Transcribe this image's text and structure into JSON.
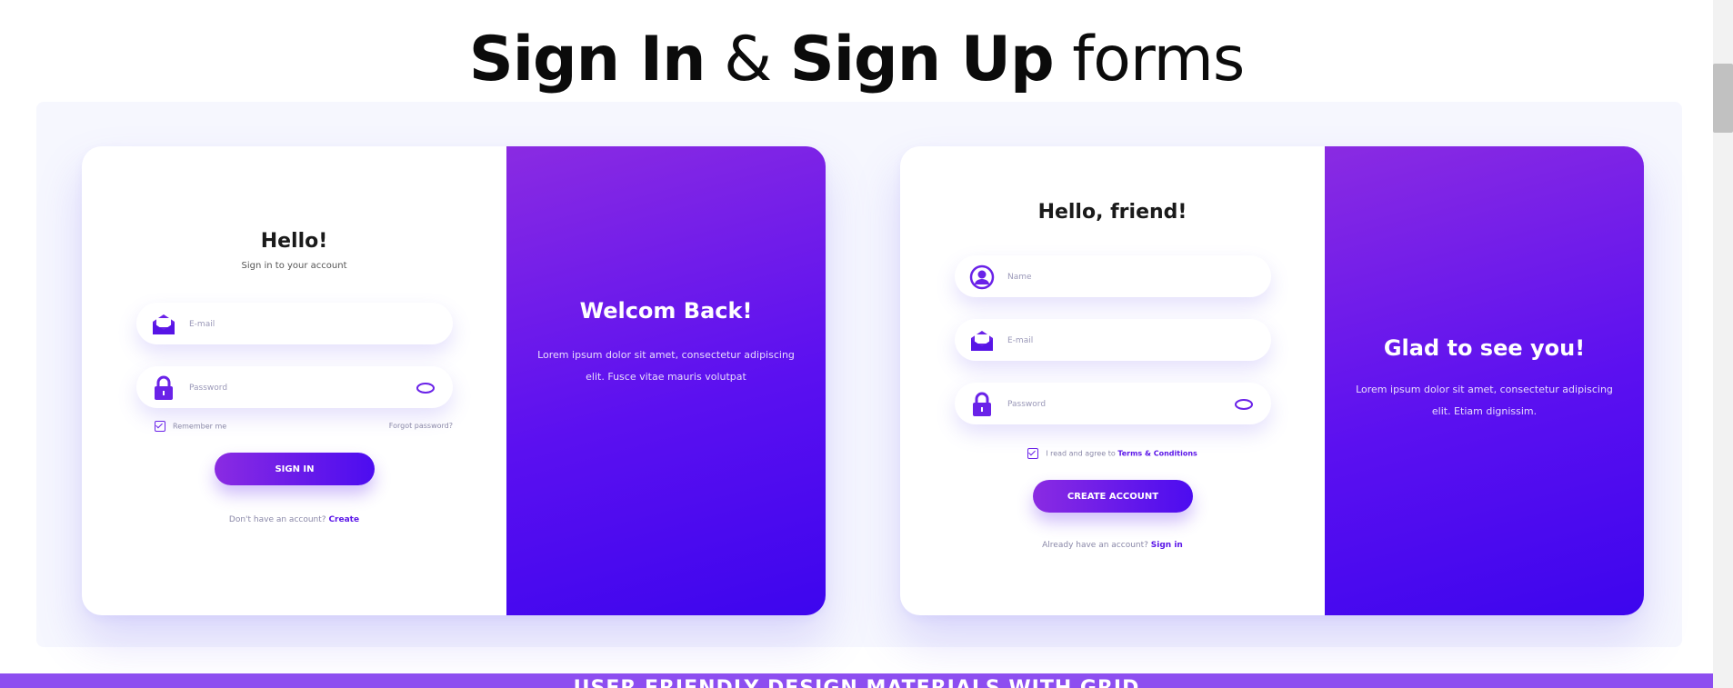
{
  "title": {
    "bold1": "Sign In",
    "amp": " & ",
    "bold2": "Sign Up",
    "rest": " forms"
  },
  "signin": {
    "heading": "Hello!",
    "subheading": "Sign in to your account",
    "email_placeholder": "E-mail",
    "password_placeholder": "Password",
    "remember_label": "Remember me",
    "forgot_label": "Forgot password?",
    "button_label": "SIGN IN",
    "footer_text": "Don't have an account?",
    "footer_link": "Create",
    "panel_title": "Welcom Back!",
    "panel_text": "Lorem ipsum dolor sit amet, consectetur adipiscing elit. Fusce vitae mauris volutpat"
  },
  "signup": {
    "heading": "Hello, friend!",
    "name_placeholder": "Name",
    "email_placeholder": "E-mail",
    "password_placeholder": "Password",
    "terms_label": "I read and agree to",
    "terms_link": "Terms & Conditions",
    "button_label": "CREATE ACCOUNT",
    "footer_text": "Already have an account?",
    "footer_link": "Sign in",
    "panel_title": "Glad to see you!",
    "panel_text": "Lorem ipsum dolor sit amet, consectetur adipiscing elit. Etiam dignissim."
  },
  "banner_text": "USER FRIENDLY DESIGN MATERIALS WITH GRID",
  "colors": {
    "accent": "#6a22e8",
    "gradient_start": "#8a2be2",
    "gradient_end": "#3d05ee"
  },
  "icons": [
    "envelope-icon",
    "lock-icon",
    "eye-icon",
    "user-icon",
    "checkbox-icon"
  ]
}
